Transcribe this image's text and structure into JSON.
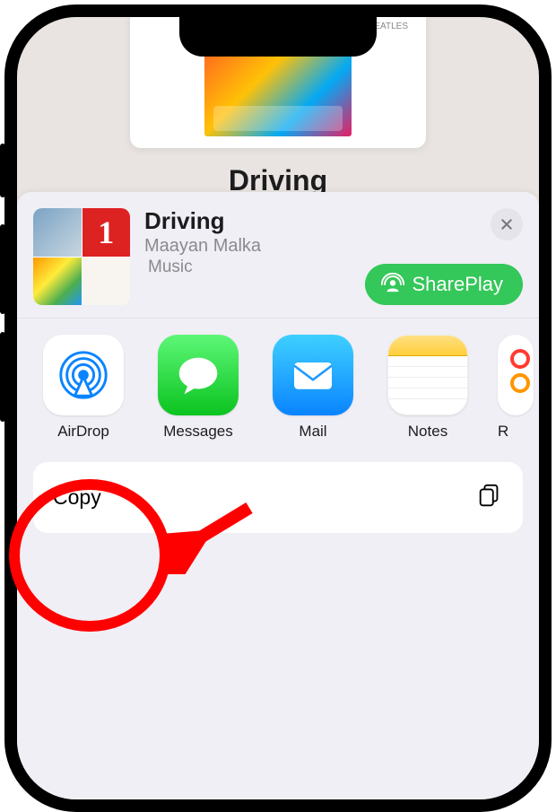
{
  "background": {
    "playlist_title": "Driving",
    "album_caption_small": "BEATLES"
  },
  "share_sheet": {
    "item_title": "Driving",
    "item_subtitle": "Maayan Malka",
    "item_app": "Music",
    "thumb2_text": "1",
    "shareplay_label": "SharePlay"
  },
  "apps": [
    {
      "id": "airdrop",
      "label": "AirDrop"
    },
    {
      "id": "messages",
      "label": "Messages"
    },
    {
      "id": "mail",
      "label": "Mail"
    },
    {
      "id": "notes",
      "label": "Notes"
    },
    {
      "id": "reminders",
      "label": "R"
    }
  ],
  "actions": {
    "copy_label": "Copy"
  }
}
